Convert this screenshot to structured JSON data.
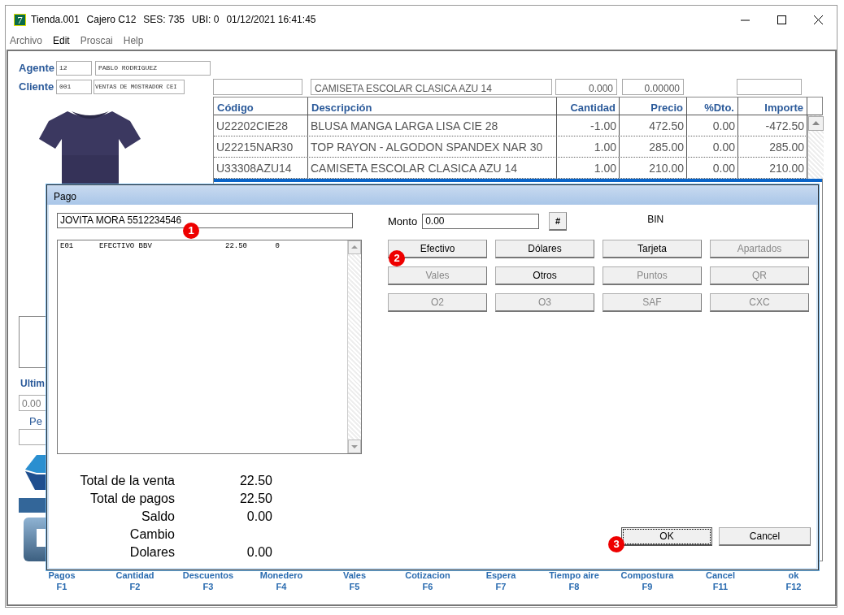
{
  "window": {
    "icon_label": "7",
    "title_parts": [
      "Tienda.001",
      "Cajero C12",
      "SES: 735",
      "UBI: 0",
      "01/12/2021 16:41:45"
    ]
  },
  "menu": [
    {
      "label": "Archivo",
      "disabled": true
    },
    {
      "label": "Edit",
      "disabled": false
    },
    {
      "label": "Proscai",
      "disabled": true
    },
    {
      "label": "Help",
      "disabled": true
    }
  ],
  "agente": {
    "label": "Agente",
    "code": "12",
    "name": "PABLO RODRIGUEZ"
  },
  "cliente": {
    "label": "Cliente",
    "code": "001",
    "name": "VENTAS DE MOSTRADOR CEI"
  },
  "item_fields": [
    "CAMISETA ESCOLAR CLASICA AZU 14",
    "0.000",
    "0.00000"
  ],
  "table": {
    "columns": [
      "Código",
      "Descripción",
      "Cantidad",
      "Precio",
      "%Dto.",
      "Importe"
    ],
    "rows": [
      [
        "U22202CIE28",
        "BLUSA MANGA LARGA LISA CIE 28",
        "-1.00",
        "472.50",
        "0.00",
        "-472.50"
      ],
      [
        "U22215NAR30",
        "TOP RAYON - ALGODON SPANDEX NAR 30",
        "1.00",
        "285.00",
        "0.00",
        "285.00"
      ],
      [
        "U33308AZU14",
        "CAMISETA ESCOLAR CLASICA AZU 14",
        "1.00",
        "210.00",
        "0.00",
        "210.00"
      ]
    ]
  },
  "side": {
    "ultimo_label": "Ultim",
    "ultimo_value": "0.00",
    "pe_label": "Pe"
  },
  "dialog": {
    "title": "Pago",
    "customer": "JOVITA MORA 5512234546",
    "payments": [
      {
        "code": "E01",
        "name": "EFECTIVO BBV",
        "amount": "22.50",
        "extra": "0"
      }
    ],
    "monto_label": "Monto",
    "monto_value": "0.00",
    "hash_button": "#",
    "bin_label": "BIN",
    "buttons": [
      {
        "label": "Efectivo",
        "disabled": false
      },
      {
        "label": "Dólares",
        "disabled": false
      },
      {
        "label": "Tarjeta",
        "disabled": false
      },
      {
        "label": "Apartados",
        "disabled": true
      },
      {
        "label": "Vales",
        "disabled": true
      },
      {
        "label": "Otros",
        "disabled": false
      },
      {
        "label": "Puntos",
        "disabled": true
      },
      {
        "label": "QR",
        "disabled": true
      },
      {
        "label": "O2",
        "disabled": true
      },
      {
        "label": "O3",
        "disabled": true
      },
      {
        "label": "SAF",
        "disabled": true
      },
      {
        "label": "CXC",
        "disabled": true
      }
    ],
    "totals": [
      {
        "label": "Total de la venta",
        "value": "22.50"
      },
      {
        "label": "Total de pagos",
        "value": "22.50"
      },
      {
        "label": "Saldo",
        "value": "0.00"
      },
      {
        "label": "Cambio"
      },
      {
        "label": "Dolares",
        "value": "0.00"
      }
    ],
    "ok": "OK",
    "cancel": "Cancel",
    "markers": [
      "1",
      "2",
      "3"
    ]
  },
  "fkeys": [
    {
      "label": "Pagos",
      "key": "F1"
    },
    {
      "label": "Cantidad",
      "key": "F2"
    },
    {
      "label": "Descuentos",
      "key": "F3"
    },
    {
      "label": "Monedero",
      "key": "F4"
    },
    {
      "label": "Vales",
      "key": "F5"
    },
    {
      "label": "Cotizacion",
      "key": "F6"
    },
    {
      "label": "Espera",
      "key": "F7"
    },
    {
      "label": "Tiempo aire",
      "key": "F8"
    },
    {
      "label": "Compostura",
      "key": "F9"
    },
    {
      "label": "Cancel",
      "key": "F11"
    },
    {
      "label": "ok",
      "key": "F12"
    }
  ]
}
